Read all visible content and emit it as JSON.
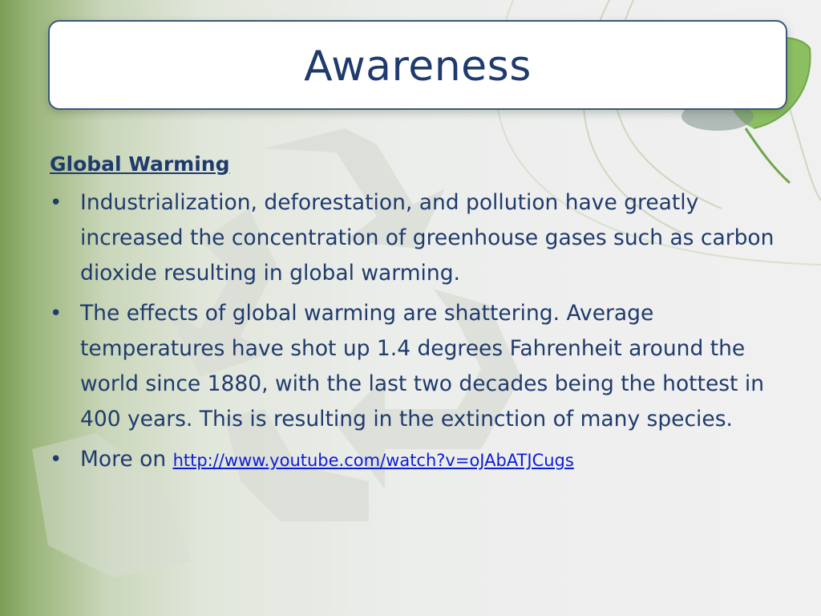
{
  "slide": {
    "title": "Awareness",
    "heading": "Global Warming",
    "bullets": [
      "Industrialization, deforestation, and pollution have greatly increased the concentration of greenhouse gases such as carbon dioxide resulting in global warming.",
      "The effects of global warming are shattering. Average temperatures have shot up 1.4 degrees Fahrenheit around the world since 1880, with the last two decades being the hottest in 400 years. This is resulting in the extinction of many species."
    ],
    "more_prefix": "More on ",
    "more_link": "http://www.youtube.com/watch?v=oJAbATJCugs",
    "bullet_char": "•"
  },
  "colors": {
    "text": "#1f3b6d",
    "link": "#0b1cd8",
    "title_border": "#3a5879",
    "green": "#7a9e56"
  },
  "icons": [
    "recycle-watermark-icon",
    "leaf-icon"
  ]
}
